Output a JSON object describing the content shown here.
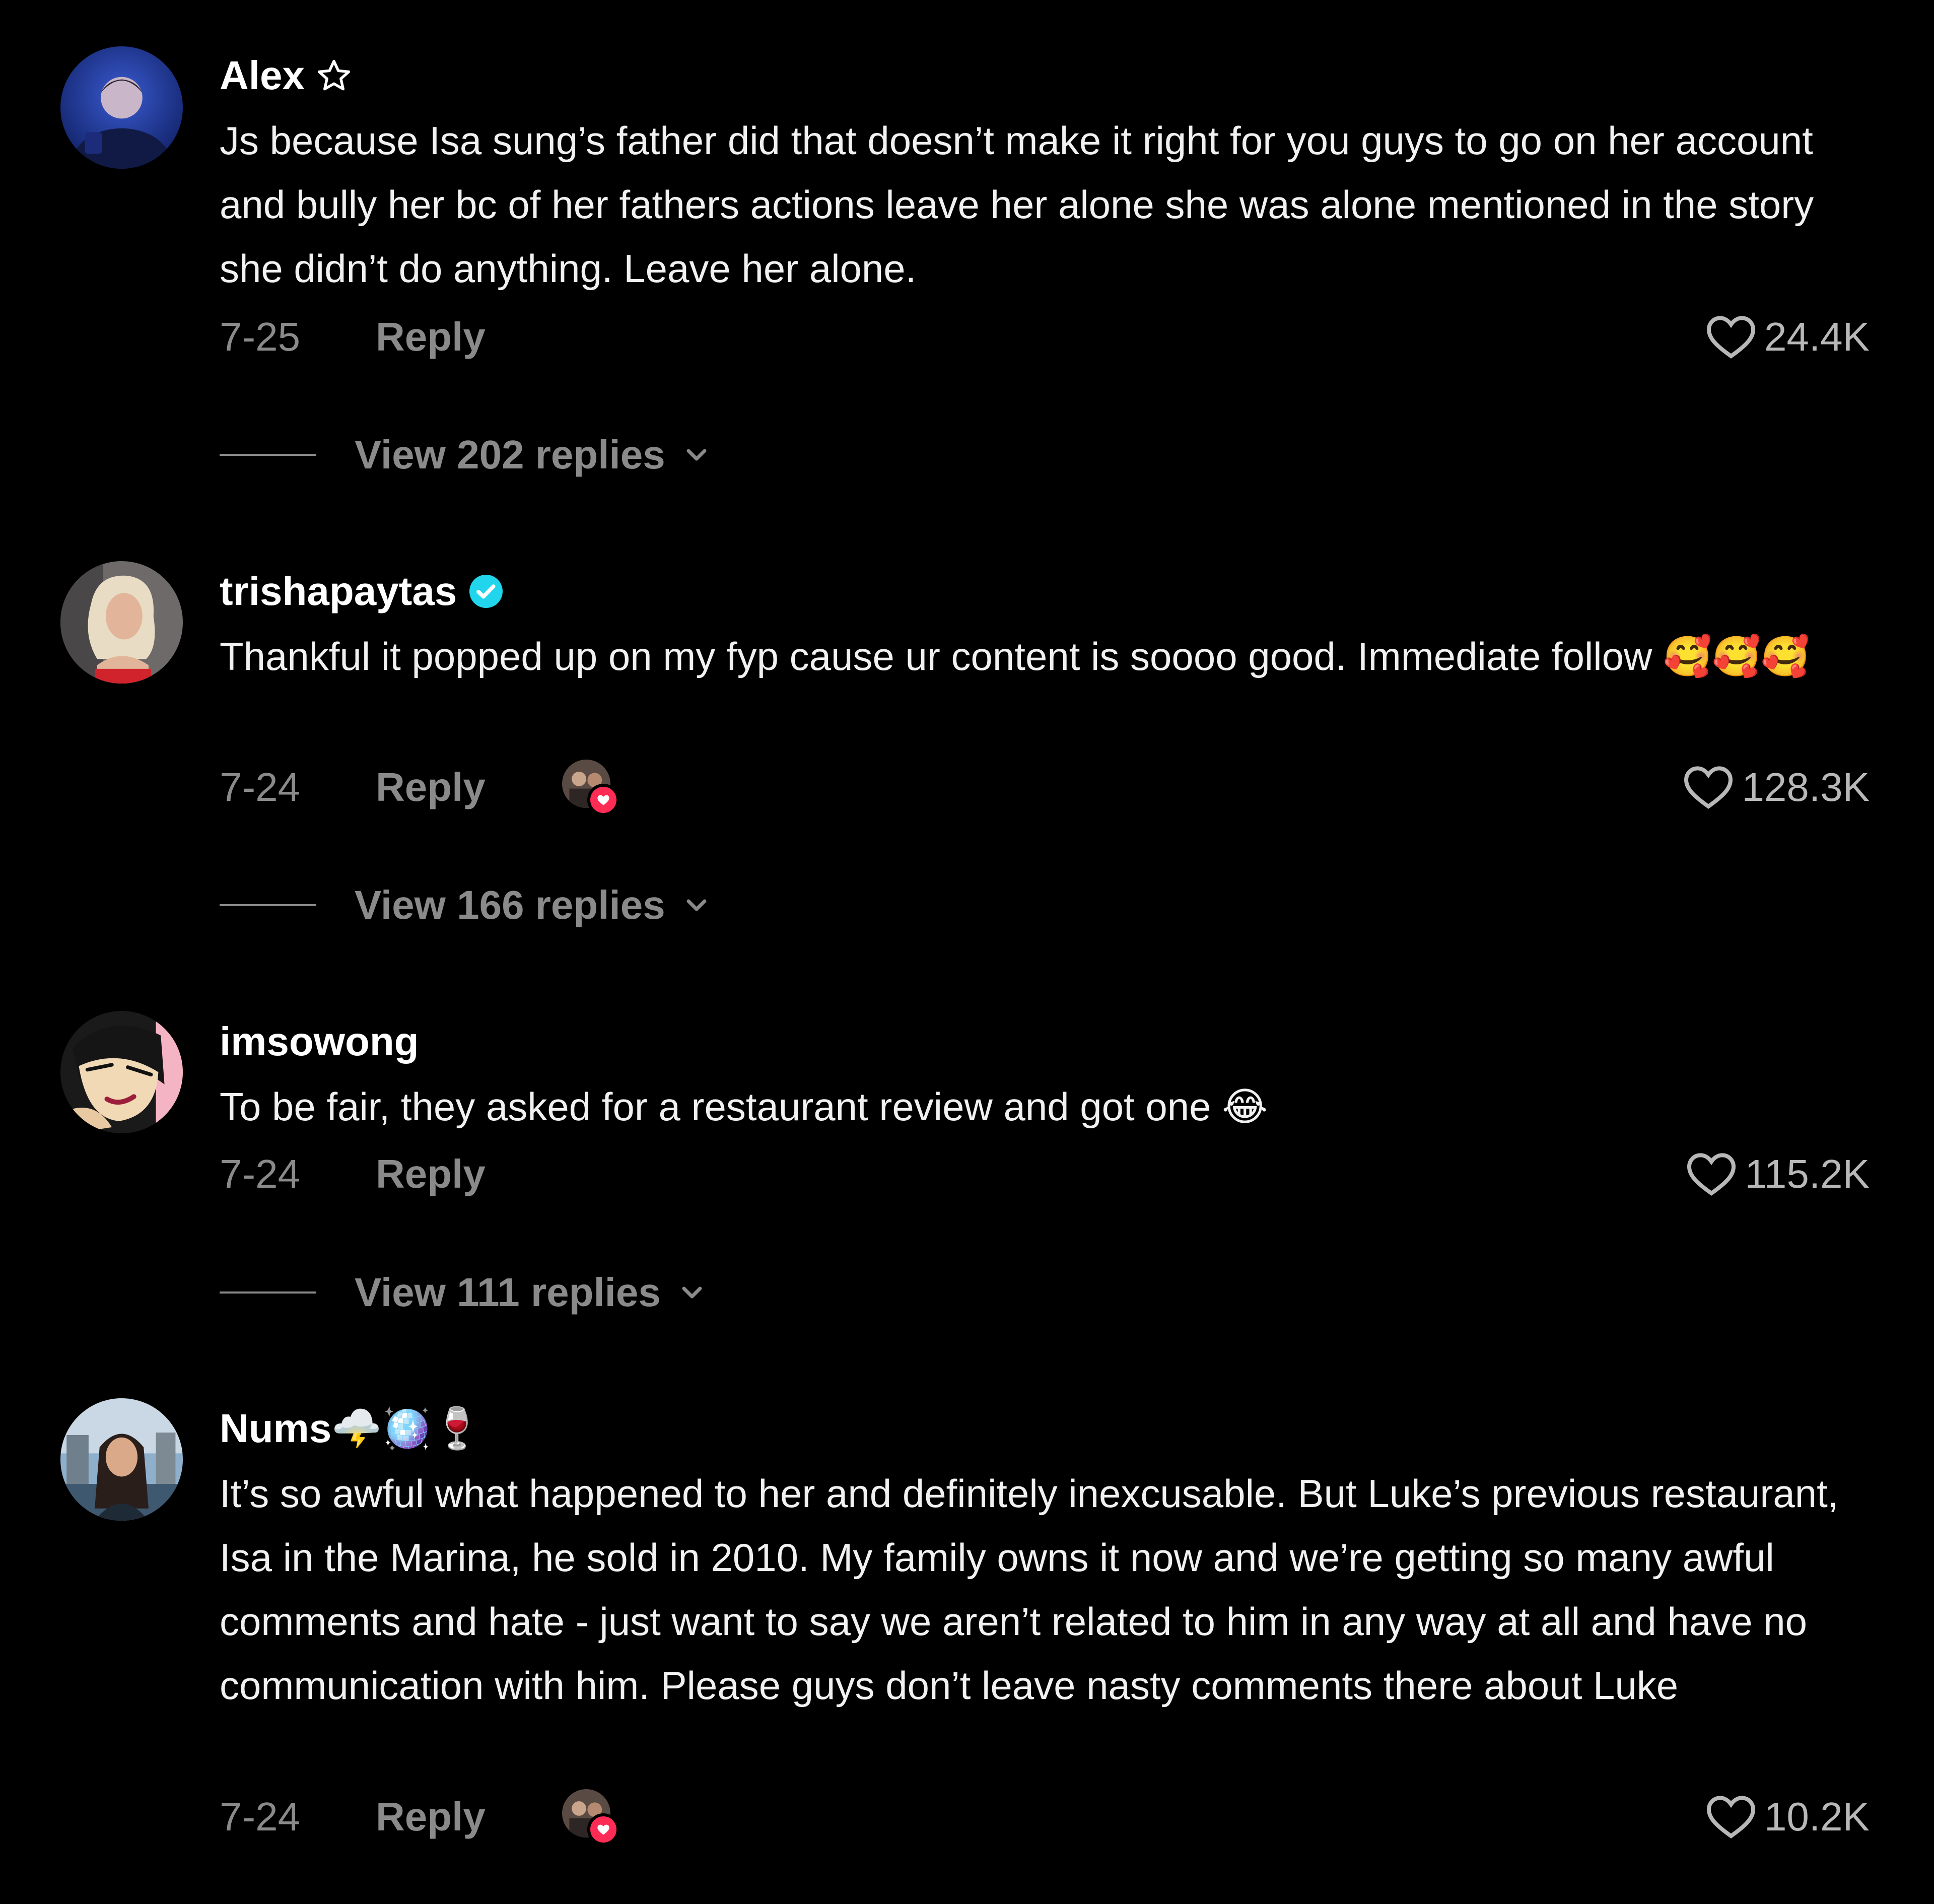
{
  "colors": {
    "background": "#000000",
    "muted": "#8a8a8a",
    "verified": "#20d5ec",
    "creator_heart": "#fe2c55"
  },
  "comments": [
    {
      "username": "Alex",
      "badge_icon": "star-outline-icon",
      "text": "Js because Isa sung’s father did that doesn’t make it right for you guys to go on her account and bully her bc of her fathers actions leave her alone she was alone mentioned in the story she didn’t do anything. Leave her alone.",
      "date": "7-25",
      "reply_label": "Reply",
      "likes": "24.4K",
      "view_replies": "View 202 replies",
      "creator_liked": false
    },
    {
      "username": "trishapaytas",
      "badge_icon": "verified-check-icon",
      "text": "Thankful it popped up on my fyp cause ur content is soooo good. Immediate follow 🥰🥰🥰",
      "date": "7-24",
      "reply_label": "Reply",
      "likes": "128.3K",
      "view_replies": "View 166 replies",
      "creator_liked": true
    },
    {
      "username": "imsowong",
      "text": "To be fair, they asked for a restaurant review and got one 😂",
      "date": "7-24",
      "reply_label": "Reply",
      "likes": "115.2K",
      "view_replies": "View 111 replies",
      "creator_liked": false
    },
    {
      "username": "Nums🌩️🪩🍷",
      "text": "It’s so awful what happened to her and definitely inexcusable. But Luke’s previous restaurant, Isa in the Marina, he sold in 2010. My family owns it now and we’re getting so many awful comments and hate - just want to say we aren’t related to him in any way at all and have no communication with him. Please guys don’t leave nasty comments there about Luke",
      "date": "7-24",
      "reply_label": "Reply",
      "likes": "10.2K",
      "creator_liked": true
    }
  ]
}
